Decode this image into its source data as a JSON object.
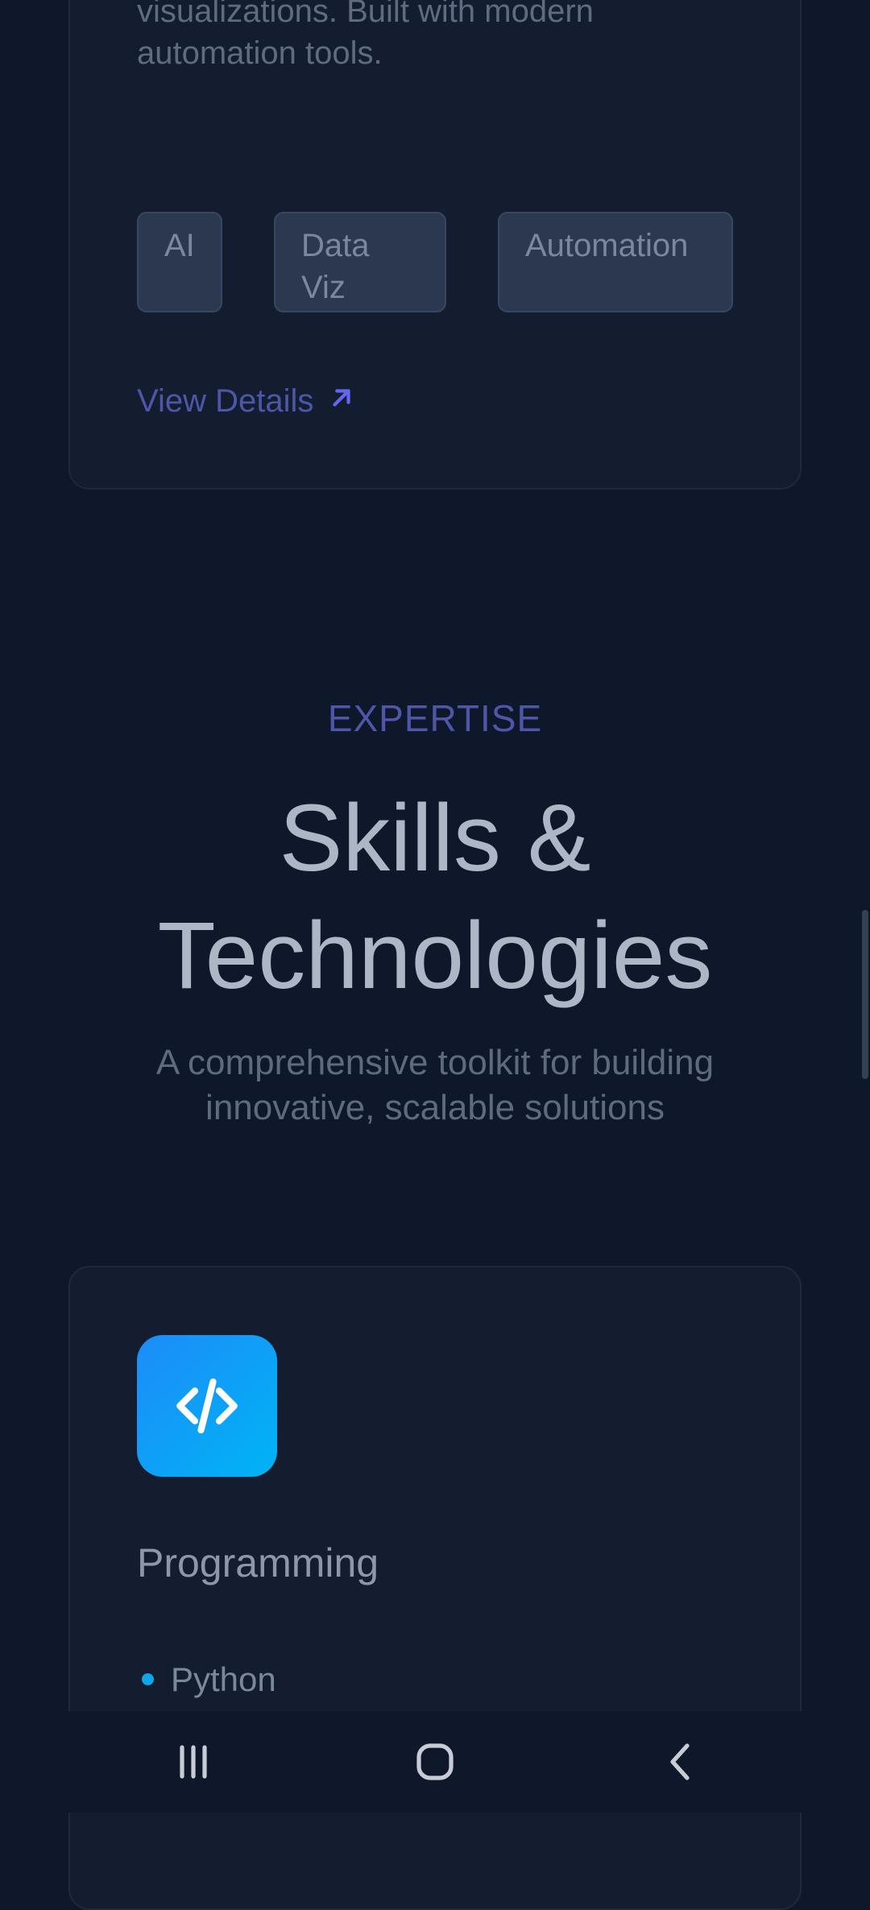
{
  "project": {
    "description": "visualizations. Built with modern automation tools.",
    "tags": [
      "AI",
      "Data Viz",
      "Automation"
    ],
    "view_details": "View Details"
  },
  "skills_section": {
    "eyebrow": "EXPERTISE",
    "title": "Skills & Technologies",
    "subtitle": "A comprehensive toolkit for building innovative, scalable solutions"
  },
  "skill_card": {
    "icon": "code-icon",
    "title": "Programming",
    "items": [
      "Python"
    ]
  },
  "navbar": {
    "icons": [
      "recent-apps-icon",
      "home-icon",
      "back-icon"
    ]
  },
  "colors": {
    "background": "#0f172a",
    "card": "#141d30",
    "accent": "#4f56a8",
    "icon_gradient_start": "#1d8cf8",
    "icon_gradient_end": "#00b4f5"
  }
}
